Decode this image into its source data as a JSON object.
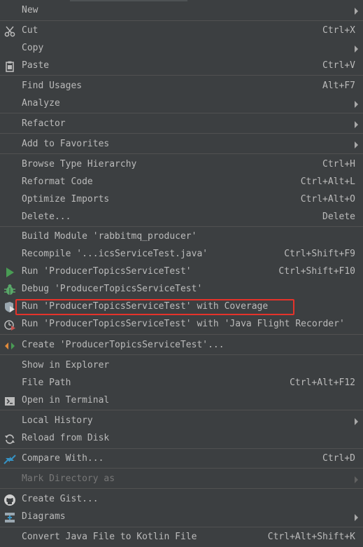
{
  "menu": {
    "new": {
      "label": "New"
    },
    "cut": {
      "label": "Cut",
      "shortcut": "Ctrl+X"
    },
    "copy": {
      "label": "Copy"
    },
    "paste": {
      "label": "Paste",
      "shortcut": "Ctrl+V"
    },
    "find_usages": {
      "label": "Find Usages",
      "shortcut": "Alt+F7"
    },
    "analyze": {
      "label": "Analyze"
    },
    "refactor": {
      "label": "Refactor"
    },
    "add_to_favorites": {
      "label": "Add to Favorites"
    },
    "browse_type_hierarchy": {
      "label": "Browse Type Hierarchy",
      "shortcut": "Ctrl+H"
    },
    "reformat_code": {
      "label": "Reformat Code",
      "shortcut": "Ctrl+Alt+L"
    },
    "optimize_imports": {
      "label": "Optimize Imports",
      "shortcut": "Ctrl+Alt+O"
    },
    "delete": {
      "label": "Delete...",
      "shortcut": "Delete"
    },
    "build_module": {
      "label": "Build Module 'rabbitmq_producer'"
    },
    "recompile": {
      "label": "Recompile '...icsServiceTest.java'",
      "shortcut": "Ctrl+Shift+F9"
    },
    "run": {
      "label": "Run 'ProducerTopicsServiceTest'",
      "shortcut": "Ctrl+Shift+F10"
    },
    "debug": {
      "label": "Debug 'ProducerTopicsServiceTest'"
    },
    "run_coverage": {
      "label": "Run 'ProducerTopicsServiceTest' with Coverage"
    },
    "run_jfr": {
      "label": "Run 'ProducerTopicsServiceTest' with 'Java Flight Recorder'"
    },
    "create": {
      "label": "Create 'ProducerTopicsServiceTest'..."
    },
    "show_in_explorer": {
      "label": "Show in Explorer"
    },
    "file_path": {
      "label": "File Path",
      "shortcut": "Ctrl+Alt+F12"
    },
    "open_in_terminal": {
      "label": "Open in Terminal"
    },
    "local_history": {
      "label": "Local History"
    },
    "reload_from_disk": {
      "label": "Reload from Disk"
    },
    "compare_with": {
      "label": "Compare With...",
      "shortcut": "Ctrl+D"
    },
    "mark_directory_as": {
      "label": "Mark Directory as"
    },
    "create_gist": {
      "label": "Create Gist..."
    },
    "diagrams": {
      "label": "Diagrams"
    },
    "convert_kotlin": {
      "label": "Convert Java File to Kotlin File",
      "shortcut": "Ctrl+Alt+Shift+K"
    }
  },
  "colors": {
    "background": "#3c3f41",
    "text": "#bbbbbb",
    "disabled_text": "#777777",
    "separator": "#515151",
    "highlight_box": "#e5332a",
    "run_green": "#499c54",
    "debug_green": "#59a869"
  },
  "icons": {
    "cut": "scissors-icon",
    "paste": "clipboard-icon",
    "run": "run-triangle-icon",
    "debug": "bug-icon",
    "run_coverage": "shield-run-icon",
    "run_jfr": "profiler-icon",
    "create": "create-config-icon",
    "open_in_terminal": "terminal-icon",
    "reload_from_disk": "reload-icon",
    "compare_with": "compare-arrows-icon",
    "create_gist": "github-icon",
    "diagrams": "diagram-icon"
  }
}
